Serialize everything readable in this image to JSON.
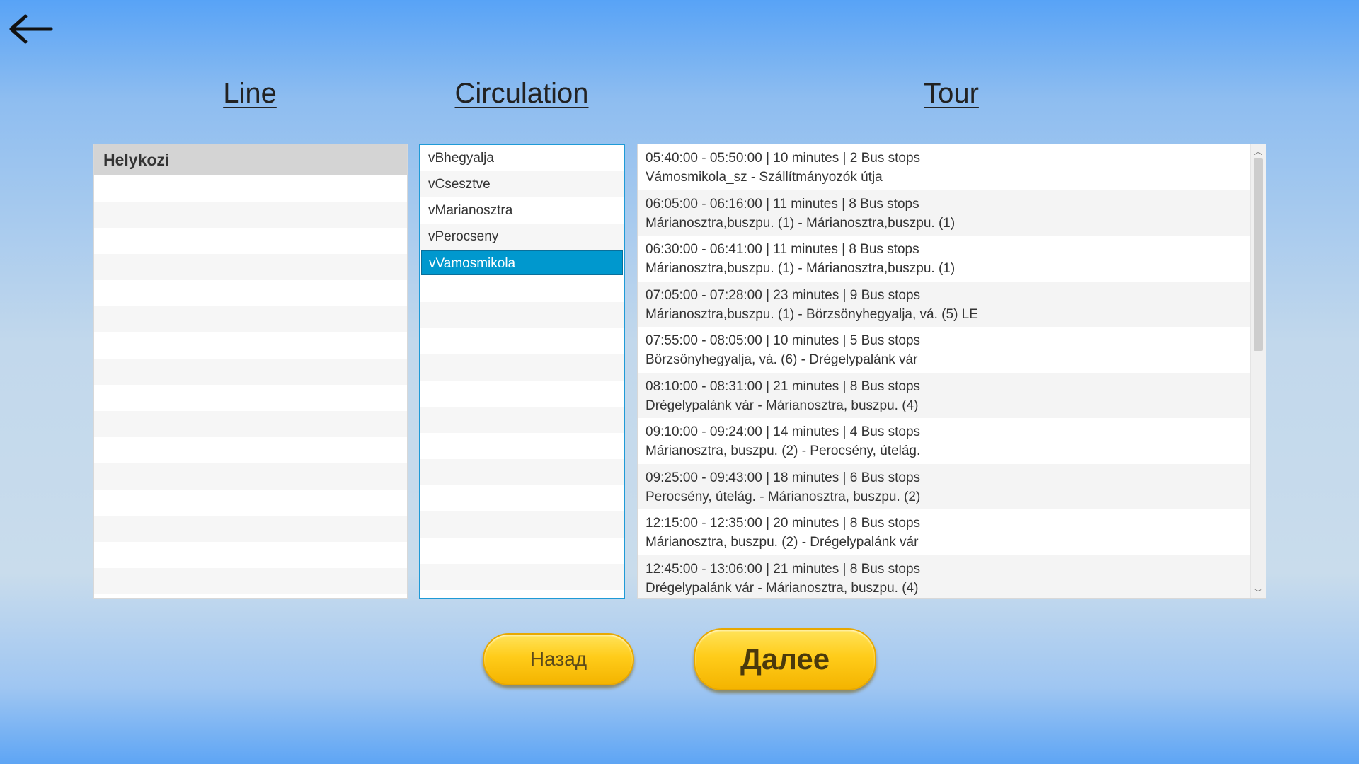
{
  "headings": {
    "line": "Line",
    "circulation": "Circulation",
    "tour": "Tour"
  },
  "line_list": {
    "header": "Helykozi"
  },
  "circulation_list": {
    "items": [
      {
        "label": "vBhegyalja"
      },
      {
        "label": "vCsesztve"
      },
      {
        "label": "vMarianosztra"
      },
      {
        "label": "vPerocseny"
      },
      {
        "label": "vVamosmikola",
        "selected": true
      }
    ]
  },
  "tour_list": {
    "items": [
      {
        "time": "05:40:00 - 05:50:00 | 10 minutes | 2 Bus stops",
        "route": "Vámosmikola_sz - Szállítmányozók útja"
      },
      {
        "time": "06:05:00 - 06:16:00 | 11 minutes | 8 Bus stops",
        "route": "Márianosztra,buszpu. (1) - Márianosztra,buszpu. (1)"
      },
      {
        "time": "06:30:00 - 06:41:00 | 11 minutes | 8 Bus stops",
        "route": "Márianosztra,buszpu. (1) - Márianosztra,buszpu. (1)"
      },
      {
        "time": "07:05:00 - 07:28:00 | 23 minutes | 9 Bus stops",
        "route": "Márianosztra,buszpu. (1) - Börzsönyhegyalja, vá. (5) LE"
      },
      {
        "time": "07:55:00 - 08:05:00 | 10 minutes | 5 Bus stops",
        "route": "Börzsönyhegyalja, vá. (6) - Drégelypalánk vár"
      },
      {
        "time": "08:10:00 - 08:31:00 | 21 minutes | 8 Bus stops",
        "route": "Drégelypalánk vár - Márianosztra, buszpu. (4)"
      },
      {
        "time": "09:10:00 - 09:24:00 | 14 minutes | 4 Bus stops",
        "route": "Márianosztra, buszpu. (2) - Perocsény, útelág."
      },
      {
        "time": "09:25:00 - 09:43:00 | 18 minutes | 6 Bus stops",
        "route": "Perocsény, útelág. - Márianosztra, buszpu. (2)"
      },
      {
        "time": "12:15:00 - 12:35:00 | 20 minutes | 8 Bus stops",
        "route": "Márianosztra, buszpu. (2) - Drégelypalánk vár"
      },
      {
        "time": "12:45:00 - 13:06:00 | 21 minutes | 8 Bus stops",
        "route": "Drégelypalánk vár - Márianosztra, buszpu. (4)"
      }
    ]
  },
  "scrollbar": {
    "up_glyph": "︿",
    "down_glyph": "﹀"
  },
  "buttons": {
    "back_label": "Назад",
    "next_label": "Далее"
  },
  "colors": {
    "selection": "#0098ce",
    "button_yellow": "#ffcc1a"
  },
  "icons": {
    "back": "arrow-left-icon"
  }
}
